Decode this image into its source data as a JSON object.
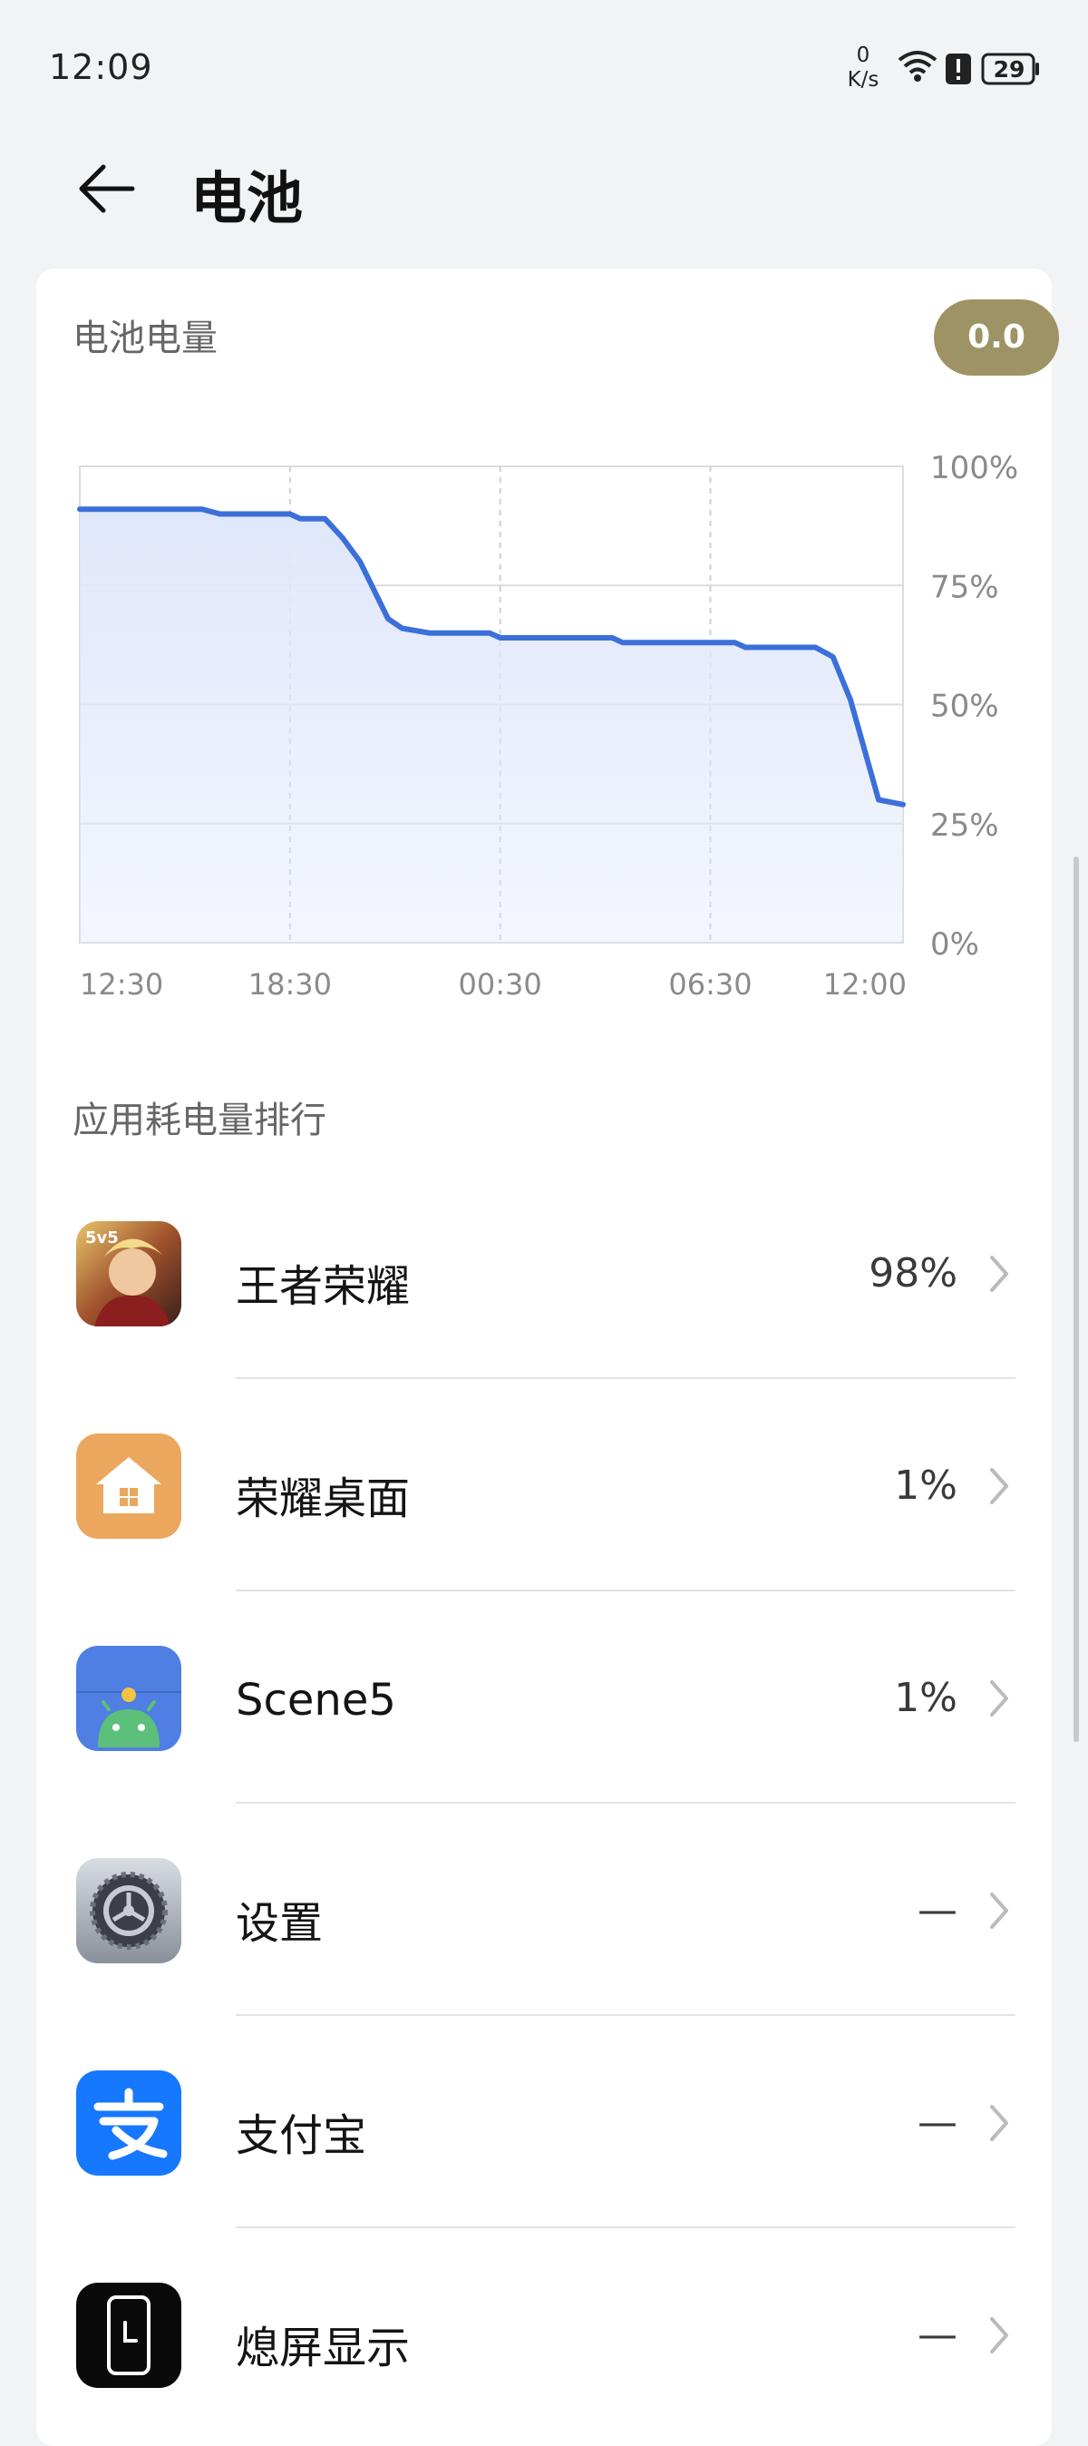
{
  "status_bar": {
    "time": "12:09",
    "net_speed_value": "0",
    "net_speed_unit": "K/s",
    "wifi_icon": "wifi-icon",
    "alert_icon": "alert-icon",
    "battery_level": "29"
  },
  "header": {
    "back_icon": "back-arrow-icon",
    "title": "电池"
  },
  "battery_section": {
    "title": "电池电量",
    "badge": "0.0"
  },
  "chart_data": {
    "type": "area",
    "title": "",
    "xlabel": "",
    "ylabel": "",
    "x_ticks": [
      "12:30",
      "18:30",
      "00:30",
      "06:30",
      "12:00"
    ],
    "y_ticks": [
      "100%",
      "75%",
      "50%",
      "25%",
      "0%"
    ],
    "ylim": [
      0,
      100
    ],
    "x_range_hours": [
      0,
      23.5
    ],
    "grid": true,
    "colors": {
      "line": "#3b6fd9",
      "fill": "#dfe7fb"
    },
    "series": [
      {
        "x": [
          0,
          3.5,
          4,
          6,
          6.3,
          7,
          7.5,
          8,
          8.8,
          9.2,
          10,
          11.7,
          12,
          14,
          15.2,
          15.5,
          18.7,
          19,
          21,
          21.5,
          22,
          22.8,
          23.5
        ],
        "values": [
          91,
          91,
          90,
          90,
          89,
          89,
          85,
          80,
          68,
          66,
          65,
          65,
          64,
          64,
          64,
          63,
          63,
          62,
          62,
          60,
          51,
          30,
          29
        ]
      }
    ]
  },
  "app_section": {
    "title": "应用耗电量排行",
    "apps": [
      {
        "name": "王者荣耀",
        "value": "98%",
        "icon": "game-hero-icon"
      },
      {
        "name": "荣耀桌面",
        "value": "1%",
        "icon": "house-icon"
      },
      {
        "name": "Scene5",
        "value": "1%",
        "icon": "android-icon"
      },
      {
        "name": "设置",
        "value": "—",
        "icon": "gear-icon"
      },
      {
        "name": "支付宝",
        "value": "—",
        "icon": "alipay-icon"
      },
      {
        "name": "熄屏显示",
        "value": "—",
        "icon": "clock-phone-icon"
      }
    ]
  }
}
